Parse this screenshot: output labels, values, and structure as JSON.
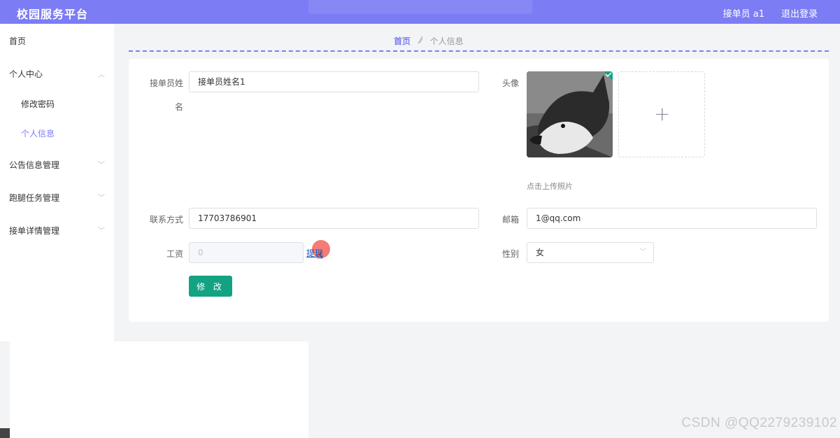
{
  "header": {
    "title": "校园服务平台",
    "user": "接单员 a1",
    "logout": "退出登录"
  },
  "sidebar": {
    "items": [
      {
        "label": "首页"
      },
      {
        "label": "个人中心"
      },
      {
        "label": "修改密码"
      },
      {
        "label": "个人信息"
      },
      {
        "label": "公告信息管理"
      },
      {
        "label": "跑腿任务管理"
      },
      {
        "label": "接单详情管理"
      }
    ],
    "active": "个人信息"
  },
  "breadcrumb": {
    "home": "首页",
    "current": "个人信息"
  },
  "form": {
    "name_label_line1": "接单员姓",
    "name_label_line2": "名",
    "name_value": "接单员姓名1",
    "avatar_label": "头像",
    "upload_tip": "点击上传照片",
    "phone_label": "联系方式",
    "phone_value": "17703786901",
    "email_label": "邮箱",
    "email_value": "1@qq.com",
    "salary_label": "工资",
    "salary_value": "0",
    "withdraw_label": "提现",
    "gender_label": "性别",
    "gender_value": "女",
    "submit_label": "修 改"
  },
  "watermark": "CSDN @QQ2279239102",
  "colors": {
    "accent": "#7c7cf5",
    "button": "#13a383"
  }
}
